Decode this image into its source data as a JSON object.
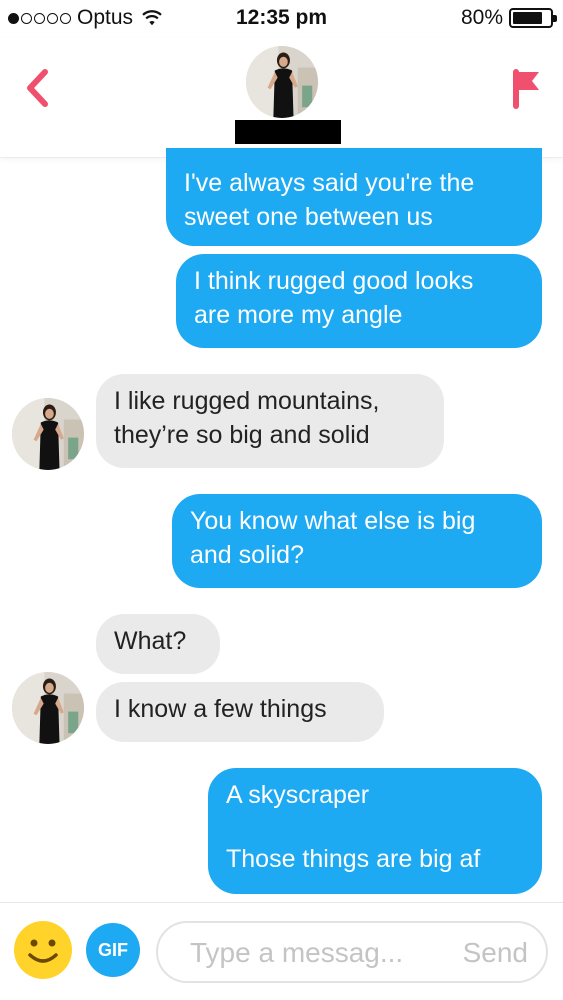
{
  "status_bar": {
    "carrier": "Optus",
    "time": "12:35 pm",
    "battery_percent": "80%",
    "battery_level": 0.8,
    "signal_bars_filled": 1,
    "signal_bars_total": 5
  },
  "header": {
    "back_icon": "chevron-left-icon",
    "report_icon": "flag-icon",
    "accent_color": "#f0506e"
  },
  "messages": [
    {
      "from": "me",
      "lines": [
        "I've always said you're the",
        "sweet one between us"
      ]
    },
    {
      "from": "me",
      "lines": [
        "I think rugged good looks",
        "are more my angle"
      ]
    },
    {
      "from": "them",
      "lines": [
        "I like rugged mountains,",
        "they’re so big and solid"
      ]
    },
    {
      "from": "me",
      "lines": [
        "You know what else is big",
        "and solid?"
      ]
    },
    {
      "from": "them",
      "lines": [
        "What?"
      ]
    },
    {
      "from": "them",
      "lines": [
        "I know a few things"
      ]
    },
    {
      "from": "me",
      "lines": [
        "A skyscraper",
        "",
        "Those things are big af"
      ]
    }
  ],
  "colors": {
    "sent_bubble": "#1ea9f3",
    "received_bubble": "#eaeaea"
  },
  "input_bar": {
    "emoji_icon": "smiley-icon",
    "gif_label": "GIF",
    "placeholder": "Type a messag...",
    "send_label": "Send"
  }
}
